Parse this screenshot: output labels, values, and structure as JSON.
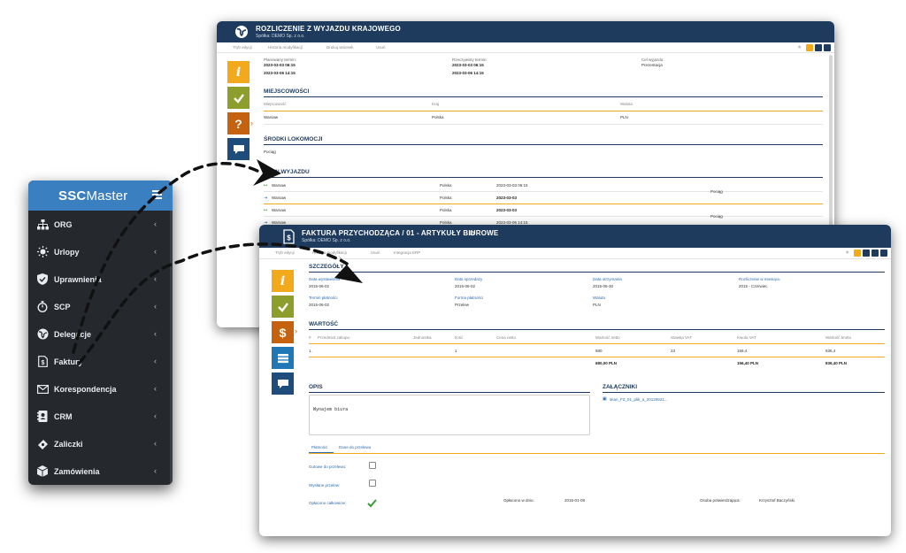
{
  "trip_window": {
    "title": "ROZLICZENIE Z WYJAZDU KRAJOWEGO",
    "company": "Spółka: DEMO Sp. z o.o.",
    "toolbar": [
      "Tryb edycji",
      "Historia modyfikacji",
      "Drukuj wniosek",
      "Usuń"
    ],
    "fields": [
      {
        "label": "Planowany termin:",
        "value1": "2023-03-03 06:15",
        "value2": "2023-03-06 14:15"
      },
      {
        "label": "Rzeczywisty termin:",
        "value1": "2023-03-03 06:15",
        "value2": "2023-03-06 14:15"
      },
      {
        "label": "Cel wyjazdu:",
        "value1": "Prezentacja"
      }
    ],
    "section_places": "MIEJSCOWOŚCI",
    "places_headers": [
      "Miejscowość",
      "Kraj",
      "Waluta"
    ],
    "places_row": [
      "Warsaw",
      "Polska",
      "PLN"
    ],
    "section_transport": "ŚRODKI LOKOMOCJI",
    "transport_value": "Pociąg",
    "section_route": "PLAN WYJAZDU",
    "route_rows": [
      {
        "place": "Warsaw",
        "country": "Polska",
        "date": "2023-03-03 06:15",
        "mode": ""
      },
      {
        "place": "Warsaw",
        "country": "Polska",
        "date": "2023-03-03",
        "mode": "Pociąg"
      },
      {
        "place": "Warsaw",
        "country": "Polska",
        "date": "2023-03-03",
        "mode": ""
      },
      {
        "place": "Warsaw",
        "country": "Polska",
        "date": "2023-03-06 14:15",
        "mode": "Pociąg"
      }
    ]
  },
  "invoice_window": {
    "title": "FAKTURA PRZYCHODZĄCA / 01 - ARTYKUŁY BIUROWE",
    "company": "Spółka: DEMO Sp. z o.o.",
    "toolbar": [
      "Tryb edycji",
      "Historia modyfikacji",
      "Usuń",
      "Integracja ERP"
    ],
    "section_details": "SZCZEGÓŁY",
    "details": [
      {
        "label": "Data wystawienia",
        "value": "2015-06-02"
      },
      {
        "label": "Data sprzedaży",
        "value": "2015-06-02"
      },
      {
        "label": "Data otrzymania",
        "value": "2015-06-30"
      },
      {
        "label": "Rozliczenie w miesiącu",
        "value": "2015 - Czerwiec"
      },
      {
        "label": "Termin płatności",
        "value": "2015-06-02"
      },
      {
        "label": "Forma płatności",
        "value": "Przelew"
      },
      {
        "label": "Waluta",
        "value": "PLN"
      }
    ],
    "section_value": "WARTOŚĆ",
    "value_headers": [
      "#",
      "Przedmiot zakupu",
      "Jednostka",
      "Ilość",
      "Cena netto",
      "Wartość netto",
      "Stawka VAT",
      "Kwota VAT",
      "Wartość brutto"
    ],
    "value_row": [
      "1.",
      "",
      "",
      "1",
      "",
      "680",
      "23",
      "156,4",
      "836,4"
    ],
    "value_totals": [
      "680,00 PLN",
      "156,40 PLN",
      "836,40 PLN"
    ],
    "section_desc": "OPIS",
    "desc_text": "Wynajem biura",
    "section_attach": "ZAŁĄCZNIKI",
    "attachment": "skan_FZ_01_plik_a_20120621...",
    "tabs": [
      "Płatności",
      "Dane do przelewu"
    ],
    "payment_rows": [
      {
        "label": "Gotowe do przelewu:"
      },
      {
        "label": "Wysłane przelew:"
      },
      {
        "label": "Opłacono całkowicie:"
      }
    ],
    "paid_on_label": "Opłacono w dniu:",
    "paid_on_value": "2015-01-08",
    "approver_label": "Osoba potwierdzająca:",
    "approver_value": "Krzysztof Baczyński"
  },
  "sidebar": {
    "brand_bold": "SSC",
    "brand_rest": "Master",
    "items": [
      {
        "label": "ORG",
        "icon": "org-chart-icon"
      },
      {
        "label": "Urlopy",
        "icon": "sun-icon"
      },
      {
        "label": "Uprawnienia",
        "icon": "shield-check-icon"
      },
      {
        "label": "SCP",
        "icon": "stopwatch-icon"
      },
      {
        "label": "Delegacje",
        "icon": "globe-icon"
      },
      {
        "label": "Faktury",
        "icon": "invoice-icon"
      },
      {
        "label": "Korespondencja",
        "icon": "envelope-icon"
      },
      {
        "label": "CRM",
        "icon": "address-book-icon"
      },
      {
        "label": "Zaliczki",
        "icon": "money-icon"
      },
      {
        "label": "Zamówienia",
        "icon": "box-icon"
      }
    ]
  },
  "colors": {
    "header_navy": "#1e3a5c",
    "accent_yellow": "#f2a91c",
    "tile_green": "#8e9e2d",
    "tile_orange": "#c46210",
    "tile_blue": "#2077b6",
    "sidebar_bg": "#25292d",
    "brand_blue": "#3a7fbf"
  }
}
